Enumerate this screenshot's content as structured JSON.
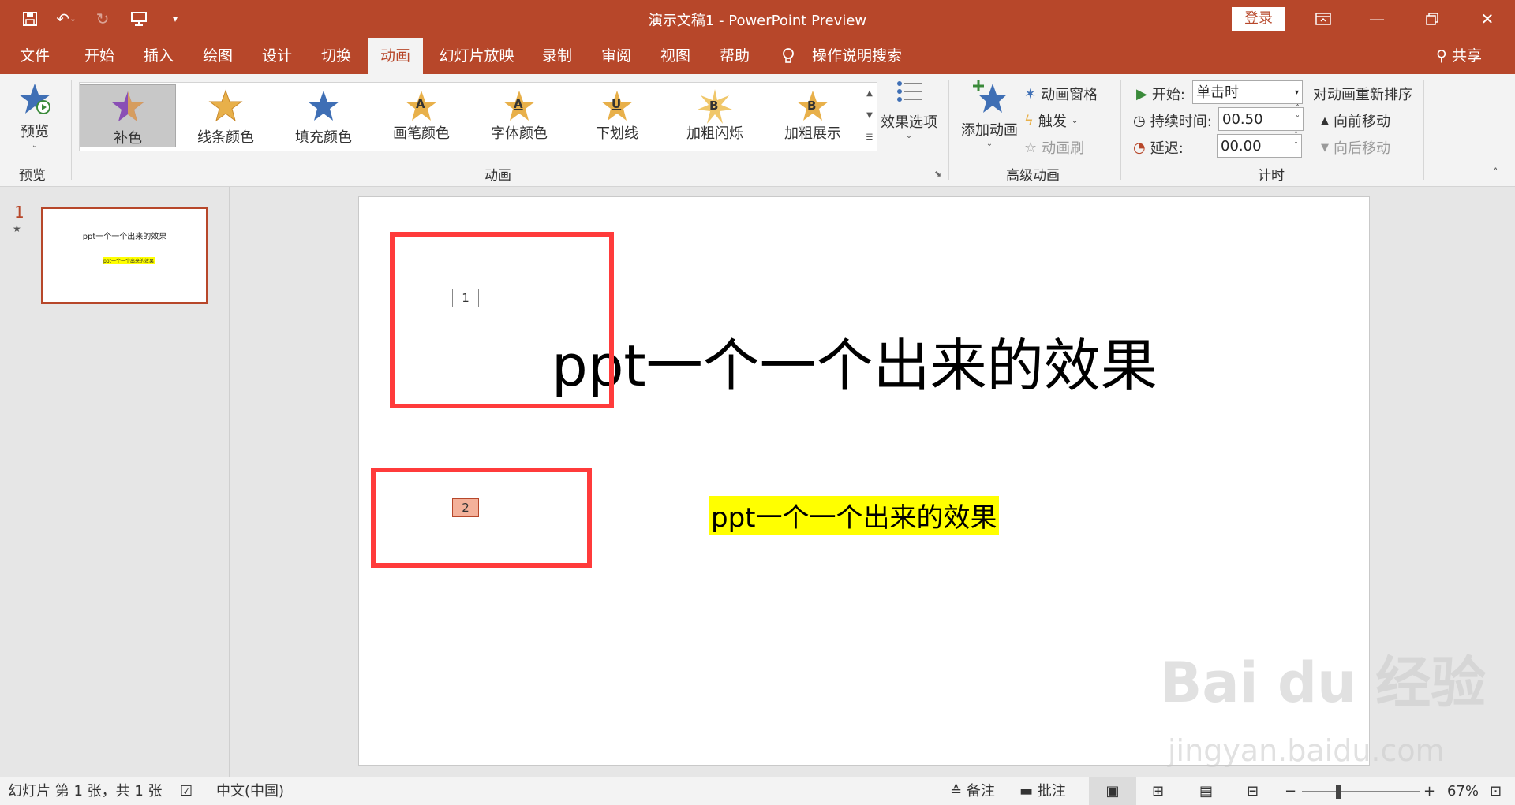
{
  "titlebar": {
    "title": "演示文稿1  -  PowerPoint Preview",
    "login": "登录"
  },
  "tabs": [
    {
      "label": "文件"
    },
    {
      "label": "开始"
    },
    {
      "label": "插入"
    },
    {
      "label": "绘图"
    },
    {
      "label": "设计"
    },
    {
      "label": "切换"
    },
    {
      "label": "动画"
    },
    {
      "label": "幻灯片放映"
    },
    {
      "label": "录制"
    },
    {
      "label": "审阅"
    },
    {
      "label": "视图"
    },
    {
      "label": "帮助"
    },
    {
      "label": "操作说明搜索"
    }
  ],
  "share": "共享",
  "ribbon": {
    "preview": {
      "button": "预览",
      "group": "预览"
    },
    "animation_gallery": [
      {
        "label": "补色",
        "letter": ""
      },
      {
        "label": "线条颜色",
        "letter": ""
      },
      {
        "label": "填充颜色",
        "letter": ""
      },
      {
        "label": "画笔颜色",
        "letter": "A"
      },
      {
        "label": "字体颜色",
        "letter": "A"
      },
      {
        "label": "下划线",
        "letter": "U"
      },
      {
        "label": "加粗闪烁",
        "letter": "B"
      },
      {
        "label": "加粗展示",
        "letter": "B"
      }
    ],
    "effect_options": "效果选项",
    "animation_group": "动画",
    "add_animation": "添加动画",
    "animation_pane": "动画窗格",
    "trigger": "触发",
    "animation_painter": "动画刷",
    "advanced_group": "高级动画",
    "start_label": "开始:",
    "start_value": "单击时",
    "duration_label": "持续时间:",
    "duration_value": "00.50",
    "delay_label": "延迟:",
    "delay_value": "00.00",
    "reorder_title": "对动画重新排序",
    "move_earlier": "向前移动",
    "move_later": "向后移动",
    "timing_group": "计时"
  },
  "thumbnail": {
    "number": "1",
    "title": "ppt一个一个出来的效果",
    "subtitle": "ppt一个一个出来的效果"
  },
  "slide": {
    "title": "ppt一个一个出来的效果",
    "subtitle": "ppt一个一个出来的效果",
    "tag1": "1",
    "tag2": "2"
  },
  "watermark": {
    "line1": "Bai du 经验",
    "line2": "jingyan.baidu.com"
  },
  "statusbar": {
    "slide_info": "幻灯片 第 1 张，共 1 张",
    "language": "中文(中国)",
    "notes": "备注",
    "comments": "批注",
    "zoom": "67%"
  },
  "colors": {
    "accent": "#b7472a",
    "highlight": "#ffff00",
    "callout": "#ff3b3b"
  }
}
